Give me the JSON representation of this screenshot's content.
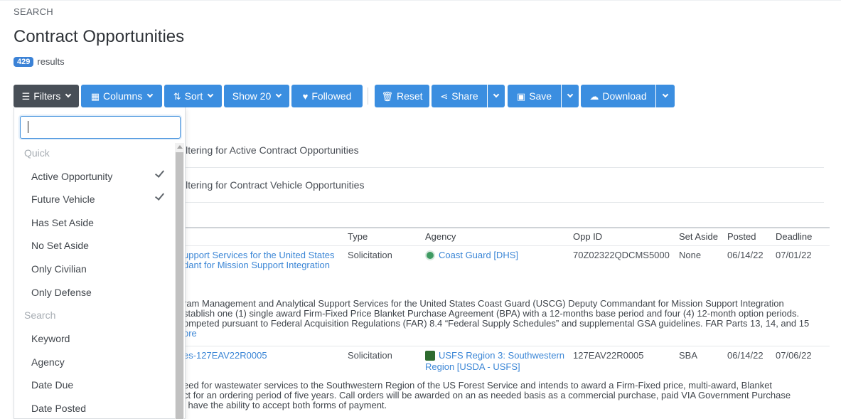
{
  "header": {
    "section": "SEARCH",
    "title": "Contract Opportunities",
    "count": "429",
    "count_suffix": "results"
  },
  "toolbar": {
    "filters": "Filters",
    "columns": "Columns",
    "sort": "Sort",
    "show": "Show 20",
    "followed": "Followed",
    "reset": "Reset",
    "share": "Share",
    "save": "Save",
    "download": "Download"
  },
  "filter_panel": {
    "search_value": "",
    "groups": [
      {
        "label": "Quick",
        "items": [
          {
            "label": "Active Opportunity",
            "checked": true
          },
          {
            "label": "Future Vehicle",
            "checked": true
          },
          {
            "label": "Has Set Aside",
            "checked": false
          },
          {
            "label": "No Set Aside",
            "checked": false
          },
          {
            "label": "Only Civilian",
            "checked": false
          },
          {
            "label": "Only Defense",
            "checked": false
          }
        ]
      },
      {
        "label": "Search",
        "items": [
          {
            "label": "Keyword",
            "checked": false
          },
          {
            "label": "Agency",
            "checked": false
          },
          {
            "label": "Date Due",
            "checked": false
          },
          {
            "label": "Date Posted",
            "checked": false
          }
        ]
      }
    ]
  },
  "active_filters": [
    "iltering for Active Contract Opportunities",
    "iltering for Contract Vehicle Opportunities"
  ],
  "table": {
    "columns": [
      "Type",
      "Agency",
      "Opp ID",
      "Set Aside",
      "Posted",
      "Deadline"
    ],
    "rows": [
      {
        "title_line1": "upport Services for the United States",
        "title_line2": "dant for Mission Support Integration",
        "type": "Solicitation",
        "agency": "Coast Guard [DHS]",
        "agency_line2": "",
        "opp_id": "70Z02322QDCMS5000",
        "set_aside": "None",
        "posted": "06/14/22",
        "deadline": "07/01/22",
        "desc_lines": [
          "ram Management and Analytical Support Services for the United States Coast Guard (USCG) Deputy Commandant for Mission Support Integration",
          "stablish one (1) single award Firm-Fixed Price Blanket Purchase Agreement (BPA) with a 12-months base period and four (4) 12-month option periods.",
          "ompeted pursuant to Federal Acquisition Regulations (FAR) 8.4 “Federal Supply Schedules” and supplemental GSA guidelines. FAR Parts 13, 14, and 15"
        ],
        "more": "ore"
      },
      {
        "title_line1": "es-127EAV22R0005",
        "title_line2": "",
        "type": "Solicitation",
        "agency": "USFS Region 3: Southwestern",
        "agency_line2": "Region [USDA - USFS]",
        "opp_id": "127EAV22R0005",
        "set_aside": "SBA",
        "posted": "06/14/22",
        "deadline": "07/06/22",
        "desc_lines": [
          "eed for wastewater services to the Southwestern Region of the US Forest Service and intends to award a Firm-Fixed price, multi-award, Blanket",
          "ct for an ordering period of five years. Call orders will be awarded on an as needed basis as a commercial purchase, paid VIA Government Purchase",
          "l have the ability to accept both forms of payment."
        ],
        "more": ""
      }
    ]
  },
  "colors": {
    "primary": "#3b8ee0",
    "dark_button": "#484f57",
    "link": "#3b86d6",
    "badge": "#3b82d6"
  }
}
